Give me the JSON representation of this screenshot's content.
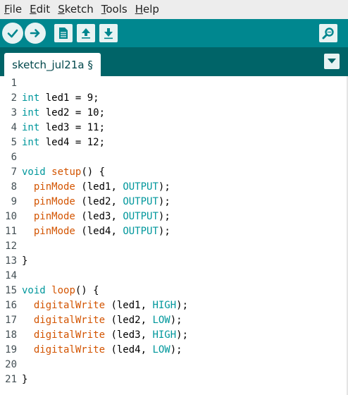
{
  "menu": {
    "items": [
      {
        "u": "F",
        "rest": "ile"
      },
      {
        "u": "E",
        "rest": "dit"
      },
      {
        "u": "S",
        "rest": "ketch"
      },
      {
        "u": "T",
        "rest": "ools"
      },
      {
        "u": "H",
        "rest": "elp"
      }
    ]
  },
  "toolbar": {
    "buttons": [
      "verify-icon",
      "upload-icon",
      "new-icon",
      "open-icon",
      "save-icon",
      "serial-monitor-icon"
    ]
  },
  "tabs": [
    {
      "label": "sketch_jul21a §"
    }
  ],
  "colors": {
    "toolbar": "#00878f",
    "tabbar": "#006468",
    "keyword": "#00979c",
    "function": "#d35400",
    "constant": "#00979c"
  },
  "code": {
    "lines": [
      {
        "n": "1",
        "tokens": []
      },
      {
        "n": "2",
        "tokens": [
          {
            "t": "kw",
            "v": "int"
          },
          {
            "t": "p",
            "v": " led1 = 9;"
          }
        ]
      },
      {
        "n": "3",
        "tokens": [
          {
            "t": "kw",
            "v": "int"
          },
          {
            "t": "p",
            "v": " led2 = 10;"
          }
        ]
      },
      {
        "n": "4",
        "tokens": [
          {
            "t": "kw",
            "v": "int"
          },
          {
            "t": "p",
            "v": " led3 = 11;"
          }
        ]
      },
      {
        "n": "5",
        "tokens": [
          {
            "t": "kw",
            "v": "int"
          },
          {
            "t": "p",
            "v": " led4 = 12;"
          }
        ]
      },
      {
        "n": "6",
        "tokens": []
      },
      {
        "n": "7",
        "tokens": [
          {
            "t": "kw",
            "v": "void"
          },
          {
            "t": "p",
            "v": " "
          },
          {
            "t": "fn",
            "v": "setup"
          },
          {
            "t": "p",
            "v": "() {"
          }
        ]
      },
      {
        "n": "8",
        "tokens": [
          {
            "t": "p",
            "v": "  "
          },
          {
            "t": "fn",
            "v": "pinMode"
          },
          {
            "t": "p",
            "v": " (led1, "
          },
          {
            "t": "const",
            "v": "OUTPUT"
          },
          {
            "t": "p",
            "v": ");"
          }
        ]
      },
      {
        "n": "9",
        "tokens": [
          {
            "t": "p",
            "v": "  "
          },
          {
            "t": "fn",
            "v": "pinMode"
          },
          {
            "t": "p",
            "v": " (led2, "
          },
          {
            "t": "const",
            "v": "OUTPUT"
          },
          {
            "t": "p",
            "v": ");"
          }
        ]
      },
      {
        "n": "10",
        "tokens": [
          {
            "t": "p",
            "v": "  "
          },
          {
            "t": "fn",
            "v": "pinMode"
          },
          {
            "t": "p",
            "v": " (led3, "
          },
          {
            "t": "const",
            "v": "OUTPUT"
          },
          {
            "t": "p",
            "v": ");"
          }
        ]
      },
      {
        "n": "11",
        "tokens": [
          {
            "t": "p",
            "v": "  "
          },
          {
            "t": "fn",
            "v": "pinMode"
          },
          {
            "t": "p",
            "v": " (led4, "
          },
          {
            "t": "const",
            "v": "OUTPUT"
          },
          {
            "t": "p",
            "v": ");"
          }
        ]
      },
      {
        "n": "12",
        "tokens": []
      },
      {
        "n": "13",
        "tokens": [
          {
            "t": "p",
            "v": "}"
          }
        ]
      },
      {
        "n": "14",
        "tokens": []
      },
      {
        "n": "15",
        "tokens": [
          {
            "t": "kw",
            "v": "void"
          },
          {
            "t": "p",
            "v": " "
          },
          {
            "t": "fn",
            "v": "loop"
          },
          {
            "t": "p",
            "v": "() {"
          }
        ]
      },
      {
        "n": "16",
        "tokens": [
          {
            "t": "p",
            "v": "  "
          },
          {
            "t": "fn",
            "v": "digitalWrite"
          },
          {
            "t": "p",
            "v": " (led1, "
          },
          {
            "t": "const",
            "v": "HIGH"
          },
          {
            "t": "p",
            "v": ");"
          }
        ]
      },
      {
        "n": "17",
        "tokens": [
          {
            "t": "p",
            "v": "  "
          },
          {
            "t": "fn",
            "v": "digitalWrite"
          },
          {
            "t": "p",
            "v": " (led2, "
          },
          {
            "t": "const",
            "v": "LOW"
          },
          {
            "t": "p",
            "v": ");"
          }
        ]
      },
      {
        "n": "18",
        "tokens": [
          {
            "t": "p",
            "v": "  "
          },
          {
            "t": "fn",
            "v": "digitalWrite"
          },
          {
            "t": "p",
            "v": " (led3, "
          },
          {
            "t": "const",
            "v": "HIGH"
          },
          {
            "t": "p",
            "v": ");"
          }
        ]
      },
      {
        "n": "19",
        "tokens": [
          {
            "t": "p",
            "v": "  "
          },
          {
            "t": "fn",
            "v": "digitalWrite"
          },
          {
            "t": "p",
            "v": " (led4, "
          },
          {
            "t": "const",
            "v": "LOW"
          },
          {
            "t": "p",
            "v": ");"
          }
        ]
      },
      {
        "n": "20",
        "tokens": []
      },
      {
        "n": "21",
        "tokens": [
          {
            "t": "p",
            "v": "}"
          }
        ]
      }
    ]
  }
}
